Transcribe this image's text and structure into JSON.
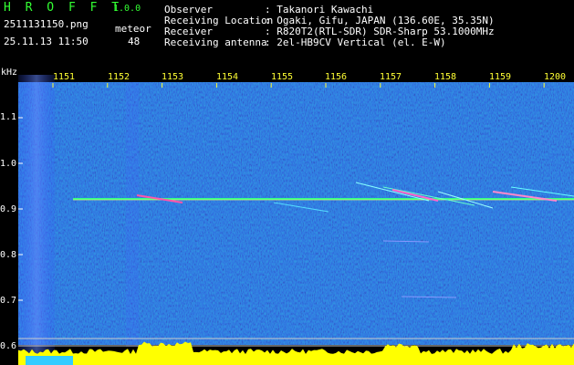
{
  "header": {
    "app_name": "H R O F F T",
    "version": "1.0.0",
    "filename": "2511131150.png",
    "datetime": "25.11.13 11:50",
    "meteor_label": "meteor",
    "meteor_count": "48",
    "info": [
      {
        "key": "Observer",
        "value": ": Takanori Kawachi"
      },
      {
        "key": "Receiving Location",
        "value": ": Ogaki, Gifu, JAPAN (136.60E, 35.35N)"
      },
      {
        "key": "Receiver",
        "value": ": R820T2(RTL-SDR) SDR-Sharp 53.1000MHz"
      },
      {
        "key": "Receiving antenna",
        "value": ": 2el-HB9CV Vertical (el. E-W)"
      }
    ]
  },
  "axis": {
    "unit": "kHz",
    "y_ticks": [
      "1.1",
      "1.0",
      "0.9",
      "0.8",
      "0.7",
      "0.6"
    ],
    "x_ticks": [
      "1151",
      "1152",
      "1153",
      "1154",
      "1155",
      "1156",
      "1157",
      "1158",
      "1159",
      "1200"
    ]
  },
  "colors": {
    "background": "#000000",
    "spectrogram": "#0a1a8a",
    "label_white": "#ffffff",
    "label_yellow": "#ffff33",
    "label_green": "#33ff33",
    "carrier": "#33ff88",
    "baseline": "#ffff00"
  }
}
